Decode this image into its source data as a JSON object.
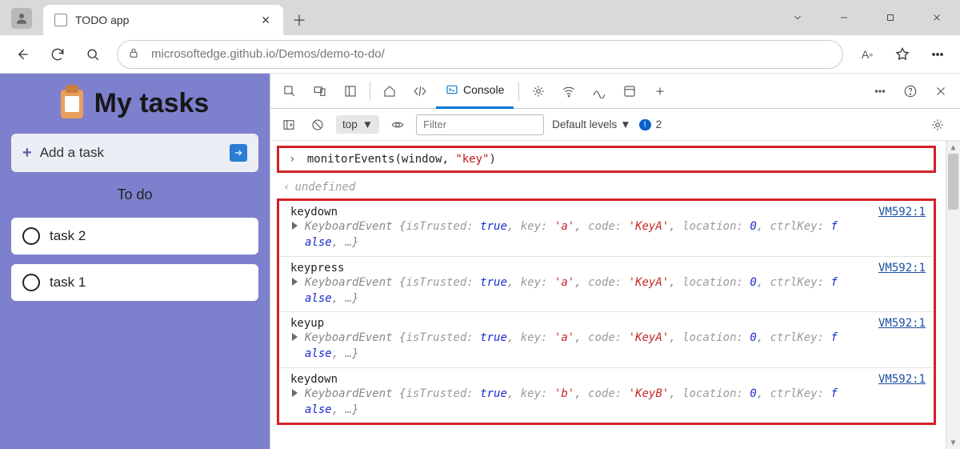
{
  "window": {
    "tab_title": "TODO app"
  },
  "toolbar": {
    "url": "microsoftedge.github.io/Demos/demo-to-do/"
  },
  "page": {
    "title": "My tasks",
    "add_label": "Add a task",
    "section_label": "To do",
    "tasks": [
      "task 2",
      "task 1"
    ]
  },
  "devtools": {
    "active_tab": "Console",
    "context": "top",
    "filter_placeholder": "Filter",
    "levels_label": "Default levels",
    "issues_count": "2"
  },
  "console": {
    "command_fn": "monitorEvents",
    "command_arg1": "window",
    "command_arg2": "\"key\"",
    "undefined_label": "undefined",
    "source_ref": "VM592:1",
    "events": [
      {
        "name": "keydown",
        "key": "'a'",
        "code": "'KeyA'"
      },
      {
        "name": "keypress",
        "key": "'a'",
        "code": "'KeyA'"
      },
      {
        "name": "keyup",
        "key": "'a'",
        "code": "'KeyA'"
      },
      {
        "name": "keydown",
        "key": "'b'",
        "code": "'KeyB'"
      }
    ],
    "event_template": {
      "class": "KeyboardEvent",
      "isTrusted": "true",
      "location": "0",
      "ctrlKey_part1": "f",
      "ctrlKey_part2": "alse",
      "ellipsis": "…"
    }
  }
}
